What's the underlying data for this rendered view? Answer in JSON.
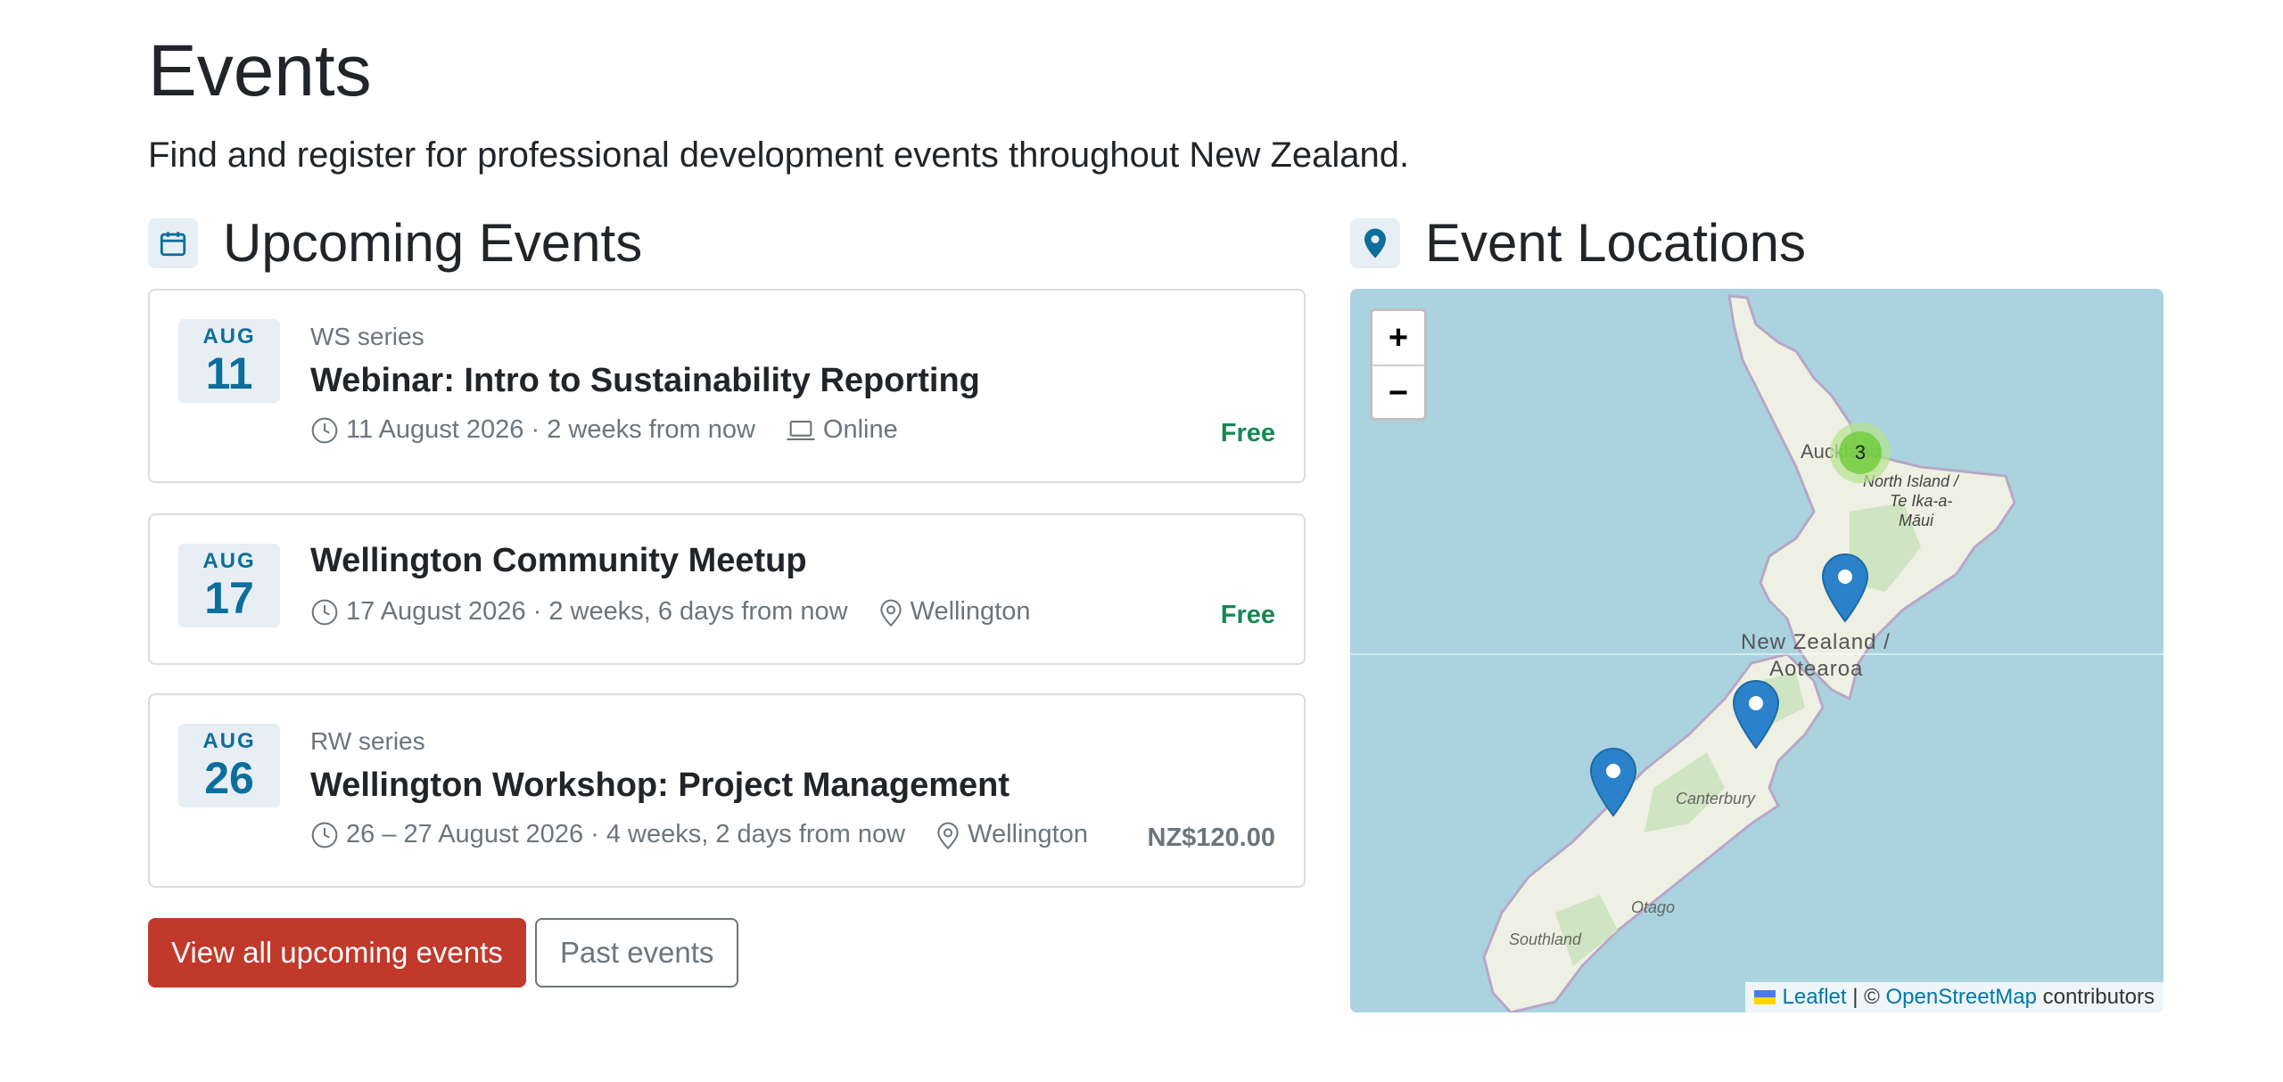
{
  "page": {
    "title": "Events",
    "lead": "Find and register for professional development events throughout New Zealand."
  },
  "upcoming": {
    "heading": "Upcoming Events",
    "icon": "calendar-icon",
    "events": [
      {
        "month": "AUG",
        "day": "11",
        "series": "WS series",
        "title": "Webinar: Intro to Sustainability Reporting",
        "when": "11 August 2026 · 2 weeks from now",
        "where": "Online",
        "where_icon": "laptop-icon",
        "price": "Free"
      },
      {
        "month": "AUG",
        "day": "17",
        "series": "",
        "title": "Wellington Community Meetup",
        "when": "17 August 2026 · 2 weeks, 6 days from now",
        "where": "Wellington",
        "where_icon": "map-pin-icon",
        "price": "Free"
      },
      {
        "month": "AUG",
        "day": "26",
        "series": "RW series",
        "title": "Wellington Workshop: Project Management",
        "when": "26 – 27 August 2026 · 4 weeks, 2 days from now",
        "where": "Wellington",
        "where_icon": "map-pin-icon",
        "price": "NZ$120.00"
      }
    ],
    "buttons": {
      "view_all": "View all upcoming events",
      "past": "Past events"
    }
  },
  "locations": {
    "heading": "Event Locations",
    "icon": "location-pin-icon",
    "map": {
      "zoom_in": "+",
      "zoom_out": "−",
      "cluster_count": "3",
      "labels": {
        "auckland": "Auckland",
        "north_island_1": "North Island /",
        "north_island_2": "Te Ika-a-",
        "north_island_3": "Māui",
        "nz_1": "New Zealand /",
        "nz_2": "Aotearoa",
        "canterbury": "Canterbury",
        "otago": "Otago",
        "southland": "Southland"
      },
      "attribution": {
        "leaflet": "Leaflet",
        "sep": "| ©",
        "osm": "OpenStreetMap",
        "contributors": "contributors"
      }
    }
  },
  "colors": {
    "accent": "#0d6e9c",
    "primary_button": "#c0392b",
    "free": "#198754",
    "muted": "#6c757d",
    "water": "#aad3df",
    "land": "#eef0e4"
  }
}
